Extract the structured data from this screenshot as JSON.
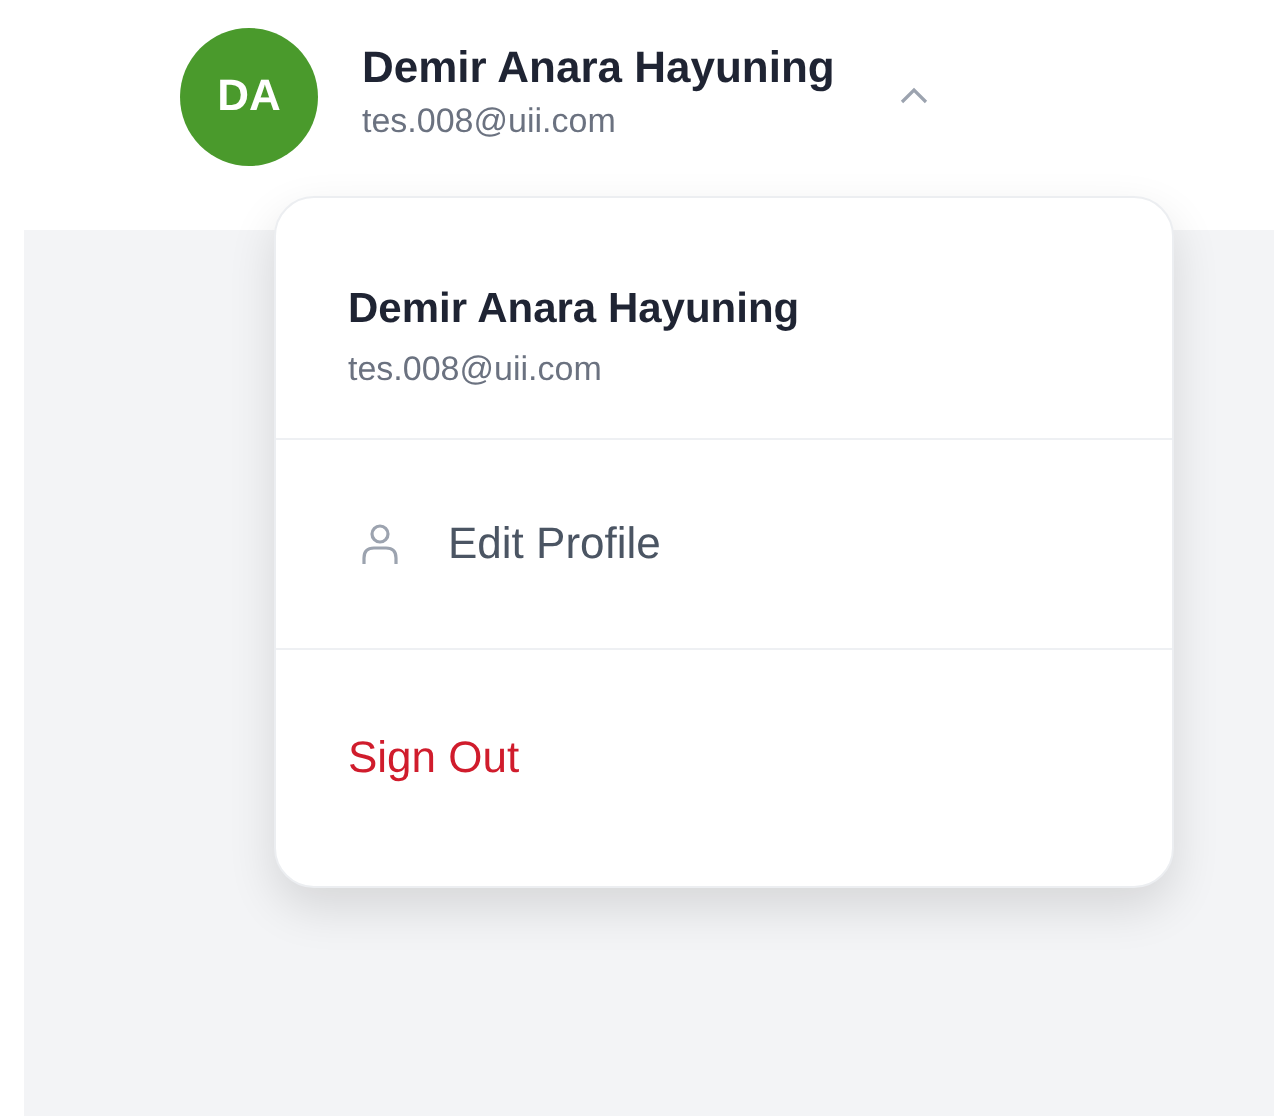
{
  "user": {
    "initials": "DA",
    "name": "Demir Anara Hayuning",
    "email": "tes.008@uii.com",
    "expanded": true
  },
  "menu": {
    "name": "Demir Anara Hayuning",
    "email": "tes.008@uii.com",
    "items": [
      {
        "kind": "profile",
        "label": "Edit Profile"
      },
      {
        "kind": "danger",
        "label": "Sign Out"
      }
    ]
  }
}
